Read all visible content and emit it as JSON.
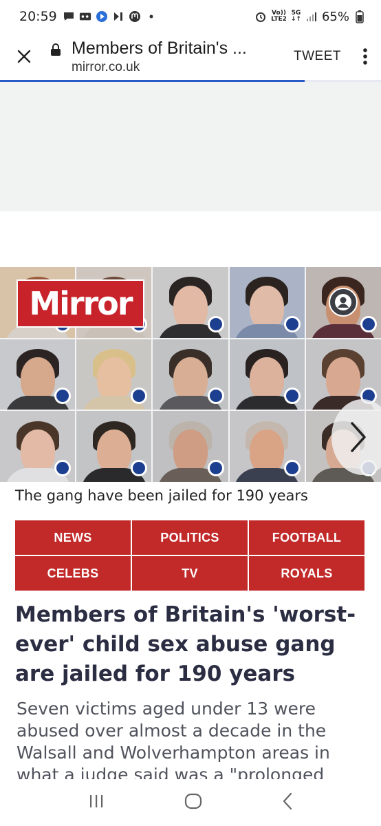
{
  "status_bar": {
    "time": "20:59",
    "network_top": "Vo))",
    "network_bottom": "LTE2",
    "network_gen": "5G",
    "battery": "65%"
  },
  "toolbar": {
    "title": "Members of Britain's ...",
    "url": "mirror.co.uk",
    "tweet_label": "TWEET",
    "load_progress": 0.8
  },
  "hero": {
    "logo_text": "Mirror",
    "caption": "The gang have been jailed for 190 years"
  },
  "nav": {
    "items": [
      {
        "label": "NEWS"
      },
      {
        "label": "POLITICS"
      },
      {
        "label": "FOOTBALL"
      },
      {
        "label": "CELEBS"
      },
      {
        "label": "TV"
      },
      {
        "label": "ROYALS"
      }
    ]
  },
  "article": {
    "headline": "Members of Britain's 'worst-ever' child sex abuse gang are jailed for 190 years",
    "standfirst": "Seven victims aged under 13 were abused over almost a decade in the Walsall and Wolverhampton areas in what a judge said was a \"prolonged"
  },
  "colors": {
    "brand_red": "#c8232b",
    "nav_red": "#c22a2a",
    "headline": "#2b2d42",
    "progress": "#2a5ac8"
  }
}
